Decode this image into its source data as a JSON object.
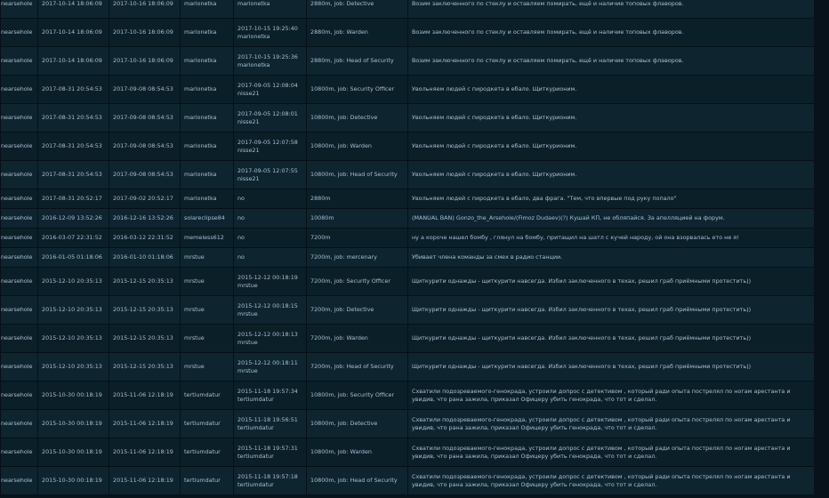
{
  "rows": [
    {
      "ckey": "nearsehole",
      "date": "2017-10-14 18:06:09",
      "expires": "2017-10-16 18:06:09",
      "admin": "marionetka",
      "unban_time": "",
      "unban_admin": "marionetka",
      "duration": "2880m, job: Detective",
      "reason": "Возим заключенного по стеклу и оставляем помирать, ещё и наличие топовых флаворов."
    },
    {
      "ckey": "nearsehole",
      "date": "2017-10-14 18:06:09",
      "expires": "2017-10-16 18:06:09",
      "admin": "marionetka",
      "unban_time": "2017-10-15 19:25:40",
      "unban_admin": "marionetka",
      "duration": "2880m, job: Warden",
      "reason": "Возим заключенного по стеклу и оставляем помирать, ещё и наличие топовых флаворов."
    },
    {
      "ckey": "nearsehole",
      "date": "2017-10-14 18:06:09",
      "expires": "2017-10-16 18:06:09",
      "admin": "marionetka",
      "unban_time": "2017-10-15 19:25:36",
      "unban_admin": "marionetka",
      "duration": "2880m, job: Head of Security",
      "reason": "Возим заключенного по стеклу и оставляем помирать, ещё и наличие топовых флаворов."
    },
    {
      "ckey": "nearsehole",
      "date": "2017-08-31 20:54:53",
      "expires": "2017-09-08 08:54:53",
      "admin": "marionetka",
      "unban_time": "2017-09-05 12:08:04",
      "unban_admin": "nisse21",
      "duration": "10800m, job: Security Officer",
      "reason": "Увольняем людей с пиродкета в ебало. Щиткурионим."
    },
    {
      "ckey": "nearsehole",
      "date": "2017-08-31 20:54:53",
      "expires": "2017-09-08 08:54:53",
      "admin": "marionetka",
      "unban_time": "2017-09-05 12:08:01",
      "unban_admin": "nisse21",
      "duration": "10800m, job: Detective",
      "reason": "Увольняем людей с пиродкета в ебало. Щиткурионим."
    },
    {
      "ckey": "nearsehole",
      "date": "2017-08-31 20:54:53",
      "expires": "2017-09-08 08:54:53",
      "admin": "marionetka",
      "unban_time": "2017-09-05 12:07:58",
      "unban_admin": "nisse21",
      "duration": "10800m, job: Warden",
      "reason": "Увольняем людей с пиродкета в ебало. Щиткурионим."
    },
    {
      "ckey": "nearsehole",
      "date": "2017-08-31 20:54:53",
      "expires": "2017-09-08 08:54:53",
      "admin": "marionetka",
      "unban_time": "2017-09-05 12:07:55",
      "unban_admin": "nisse21",
      "duration": "10800m, job: Head of Security",
      "reason": "Увольняем людей с пиродкета в ебало. Щиткурионим."
    },
    {
      "ckey": "nearsehole",
      "date": "2017-08-31 20:52:17",
      "expires": "2017-09-02 20:52:17",
      "admin": "marionetka",
      "unban_time": "no",
      "unban_admin": "",
      "duration": "2880m",
      "reason": "Увольняем людей с пиродкета в ебало, два фрага. \"Тем, что впервые под руку попало\""
    },
    {
      "ckey": "nearsehole",
      "date": "2016-12-09 13:52:26",
      "expires": "2016-12-16 13:52:26",
      "admin": "solareclipse84",
      "unban_time": "no",
      "unban_admin": "",
      "duration": "10080m",
      "reason": "(MANUAL BAN) Gonzo_the_Arsehole/(Fimoz Dudaev)(?) Кушай КП, не обляпайся. За апелляцией на форум."
    },
    {
      "ckey": "nearsehole",
      "date": "2016-03-07 22:31:52",
      "expires": "2016-03-12 22:31:52",
      "admin": "memeless612",
      "unban_time": "no",
      "unban_admin": "",
      "duration": "7200m",
      "reason": "ну а короче нашел бомбу , глянул на бомбу, притащил на шатл с кучей народу, ой она взорвалась ето не я!"
    },
    {
      "ckey": "nearsehole",
      "date": "2016-01-05 01:18:06",
      "expires": "2016-01-10 01:18:06",
      "admin": "mrstue",
      "unban_time": "no",
      "unban_admin": "",
      "duration": "7200m, job: mercenary",
      "reason": "Убивает члена команды за смех в радио станции."
    },
    {
      "ckey": "nearsehole",
      "date": "2015-12-10 20:35:13",
      "expires": "2015-12-15 20:35:13",
      "admin": "mrstue",
      "unban_time": "2015-12-12 00:18:19",
      "unban_admin": "mrstue",
      "duration": "7200m, job: Security Officer",
      "reason": "Щиткурити однажды - щиткурити навсегда. Избил заключенного в техах, решил граб приёмными протестить))"
    },
    {
      "ckey": "nearsehole",
      "date": "2015-12-10 20:35:13",
      "expires": "2015-12-15 20:35:13",
      "admin": "mrstue",
      "unban_time": "2015-12-12 00:18:15",
      "unban_admin": "mrstue",
      "duration": "7200m, job: Detective",
      "reason": "Щиткурити однажды - щиткурити навсегда. Избил заключенного в техах, решил граб приёмными протестить))"
    },
    {
      "ckey": "nearsehole",
      "date": "2015-12-10 20:35:13",
      "expires": "2015-12-15 20:35:13",
      "admin": "mrstue",
      "unban_time": "2015-12-12 00:18:13",
      "unban_admin": "mrstue",
      "duration": "7200m, job: Warden",
      "reason": "Щиткурити однажды - щиткурити навсегда. Избил заключенного в техах, решил граб приёмными протестить))"
    },
    {
      "ckey": "nearsehole",
      "date": "2015-12-10 20:35:13",
      "expires": "2015-12-15 20:35:13",
      "admin": "mrstue",
      "unban_time": "2015-12-12 00:18:11",
      "unban_admin": "mrstue",
      "duration": "7200m, job: Head of Security",
      "reason": "Щиткурити однажды - щиткурити навсегда. Избил заключенного в техах, решил граб приёмными протестить))"
    },
    {
      "ckey": "nearsehole",
      "date": "2015-10-30 00:18:19",
      "expires": "2015-11-06 12:18:19",
      "admin": "tertiumdatur",
      "unban_time": "2015-11-18 19:57:34",
      "unban_admin": "tertiumdatur",
      "duration": "10800m, job: Security Officer",
      "reason": "Схватили подозреваемого-генокрада, устроили допрос с детективом , который ради опыта пострелял по ногам арестанта и увидив, что рана зажила, приказал Офицеру убить генокрада, что тот и сделал."
    },
    {
      "ckey": "nearsehole",
      "date": "2015-10-30 00:18:19",
      "expires": "2015-11-06 12:18:19",
      "admin": "tertiumdatur",
      "unban_time": "2015-11-18 19:56:51",
      "unban_admin": "tertiumdatur",
      "duration": "10800m, job: Detective",
      "reason": "Схватили подозреваемого-генокрада, устроили допрос с детективом , который ради опыта пострелял по ногам арестанта и увидив, что рана зажила, приказал Офицеру убить генокрада, что тот и сделал."
    },
    {
      "ckey": "nearsehole",
      "date": "2015-10-30 00:18:19",
      "expires": "2015-11-06 12:18:19",
      "admin": "tertiumdatur",
      "unban_time": "2015-11-18 19:57:31",
      "unban_admin": "tertiumdatur",
      "duration": "10800m, job: Warden",
      "reason": "Схватили подозреваемого-генокрада, устроили допрос с детективом , который ради опыта пострелял по ногам арестанта и увидив, что рана зажила, приказал Офицеру убить генокрада, что тот и сделал."
    },
    {
      "ckey": "nearsehole",
      "date": "2015-10-30 00:18:19",
      "expires": "2015-11-06 12:18:19",
      "admin": "tertiumdatur",
      "unban_time": "2015-11-18 19:57:18",
      "unban_admin": "tertiumdatur",
      "duration": "10800m, job: Head of Security",
      "reason": "Схватили подозреваемого-генокрада, устроили допрос с детективом , который ради опыта пострелял по ногам арестанта и увидив, что рана зажила, приказал Офицеру убить генокрада, что тот и сделал."
    }
  ]
}
